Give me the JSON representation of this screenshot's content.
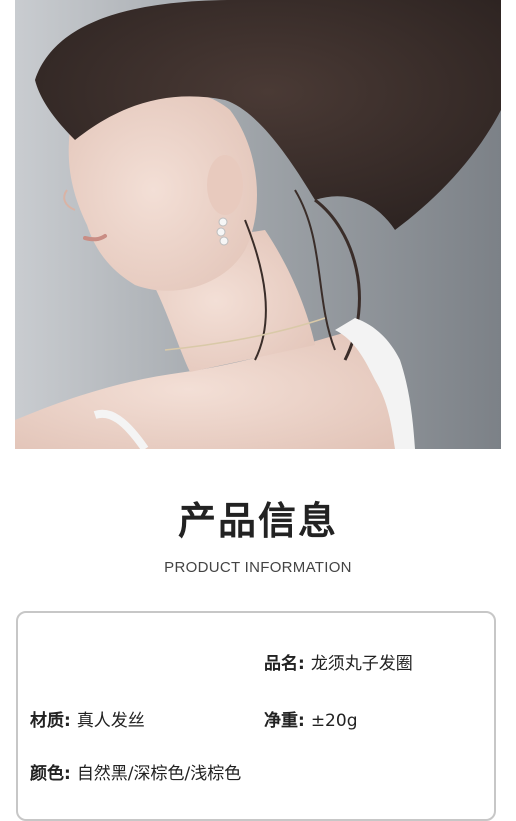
{
  "photo": {
    "description_icon": "model-photo"
  },
  "heading": {
    "title_cn": "产品信息",
    "title_en": "PRODUCT INFORMATION"
  },
  "info": {
    "name": {
      "key": "品名:",
      "value": "龙须丸子发圈"
    },
    "material": {
      "key": "材质:",
      "value": "真人发丝"
    },
    "weight": {
      "key": "净重:",
      "value": "±20g"
    },
    "color": {
      "key": "颜色:",
      "value": "自然黑/深棕色/浅棕色"
    }
  },
  "colors": {
    "background": "#ffffff",
    "card_border": "#c7c7c7",
    "photo_backdrop": "#8f9499"
  }
}
